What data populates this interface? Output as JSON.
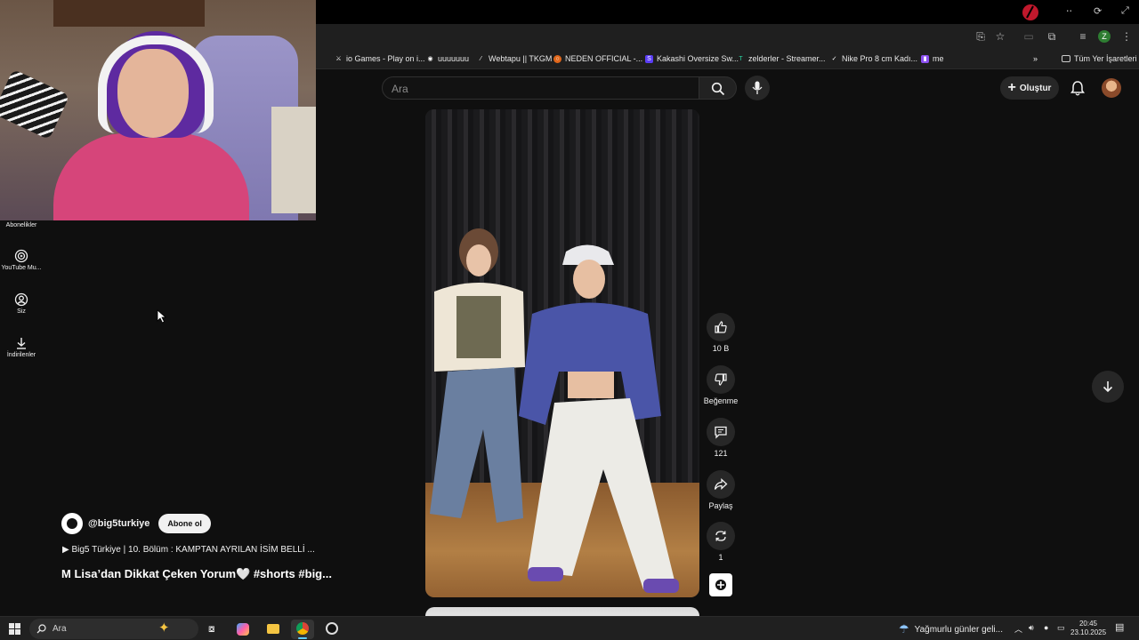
{
  "browser": {
    "bookmarks": [
      {
        "label": "io Games - Play on i...",
        "icon": "crossed-swords-icon"
      },
      {
        "label": "uuuuuuu",
        "icon": "github-icon"
      },
      {
        "label": "Webtapu || TKGM",
        "icon": "quill-icon"
      },
      {
        "label": "NEDEN OFFICIAL -...",
        "icon": "circle-logo-icon"
      },
      {
        "label": "Kakashi Oversize Sw...",
        "icon": "s-logo-icon"
      },
      {
        "label": "zelderler - Streamer...",
        "icon": "tt-logo-icon"
      },
      {
        "label": "Nike Pro 8 cm Kadı...",
        "icon": "nike-icon"
      },
      {
        "label": "me",
        "icon": "twitch-icon"
      }
    ],
    "all_bookmarks_label": "Tüm Yer İşaretleri",
    "profile_initial": "Z"
  },
  "youtube": {
    "search_placeholder": "Ara",
    "create_label": "Oluştur",
    "sidebar": [
      {
        "label": "Abonelikler",
        "icon": "subscriptions-icon"
      },
      {
        "label": "YouTube Mu...",
        "icon": "youtube-music-icon"
      },
      {
        "label": "Siz",
        "icon": "you-icon"
      },
      {
        "label": "İndirilenler",
        "icon": "download-icon"
      }
    ],
    "short": {
      "channel": "@big5turkiye",
      "subscribe_label": "Abone ol",
      "playlist": "▶ Big5 Türkiye | 10. Bölüm : KAMPTAN AYRILAN İSİM BELLİ ...",
      "title": "M Lisa’dan Dikkat Çeken Yorum🤍  #shorts #big..."
    },
    "actions": {
      "likes": "10 B",
      "dislike_label": "Beğenme",
      "comments": "121",
      "share_label": "Paylaş",
      "remix_count": "1"
    }
  },
  "taskbar": {
    "search_placeholder": "Ara",
    "weather": "Yağmurlu günler geli...",
    "time": "20:45",
    "date": "23.10.2025"
  },
  "colors": {
    "background": "#0f0f0f",
    "button_bg": "#272727",
    "chrome_bar": "#1f1f1f",
    "taskbar": "#202020",
    "accent": "#60cdff"
  }
}
